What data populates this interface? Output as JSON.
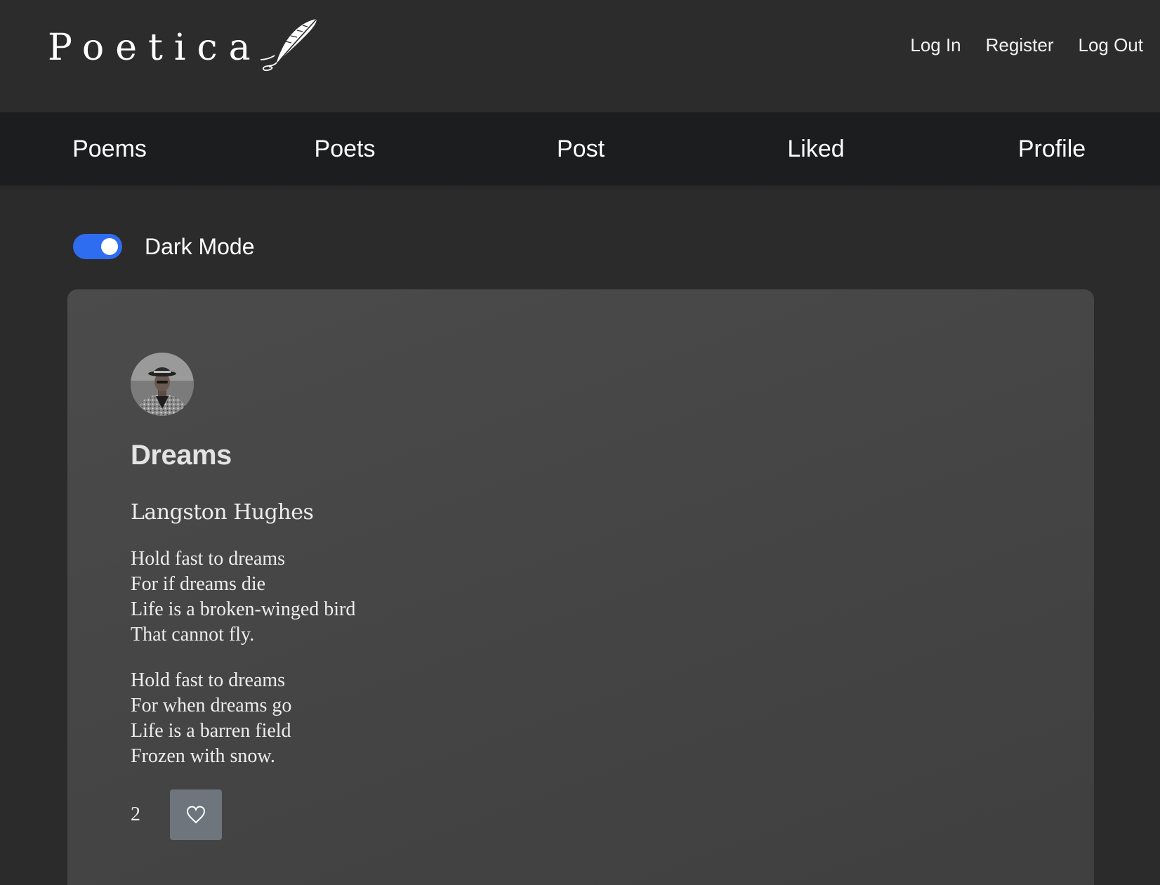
{
  "header": {
    "logo_text": "Poetica",
    "logo_icon": "quill-icon",
    "auth_links": [
      {
        "label": "Log In"
      },
      {
        "label": "Register"
      },
      {
        "label": "Log Out"
      }
    ]
  },
  "nav": {
    "items": [
      {
        "label": "Poems"
      },
      {
        "label": "Poets"
      },
      {
        "label": "Post"
      },
      {
        "label": "Liked"
      },
      {
        "label": "Profile"
      }
    ]
  },
  "dark_mode": {
    "label": "Dark Mode",
    "enabled": true,
    "accent_color": "#2f6df0"
  },
  "poem": {
    "title": "Dreams",
    "author": "Langston Hughes",
    "avatar_icon": "author-avatar",
    "stanzas": [
      [
        "Hold fast to dreams",
        "For if dreams die",
        "Life is a broken-winged bird",
        "That cannot fly."
      ],
      [
        "Hold fast to dreams",
        "For when dreams go",
        "Life is a barren field",
        "Frozen with snow."
      ]
    ],
    "like_count": "2",
    "like_icon": "heart-icon"
  },
  "colors": {
    "background": "#2b2b2c",
    "navbar": "#1c1d1f",
    "card": "#474747",
    "like_button": "#6f757d"
  }
}
